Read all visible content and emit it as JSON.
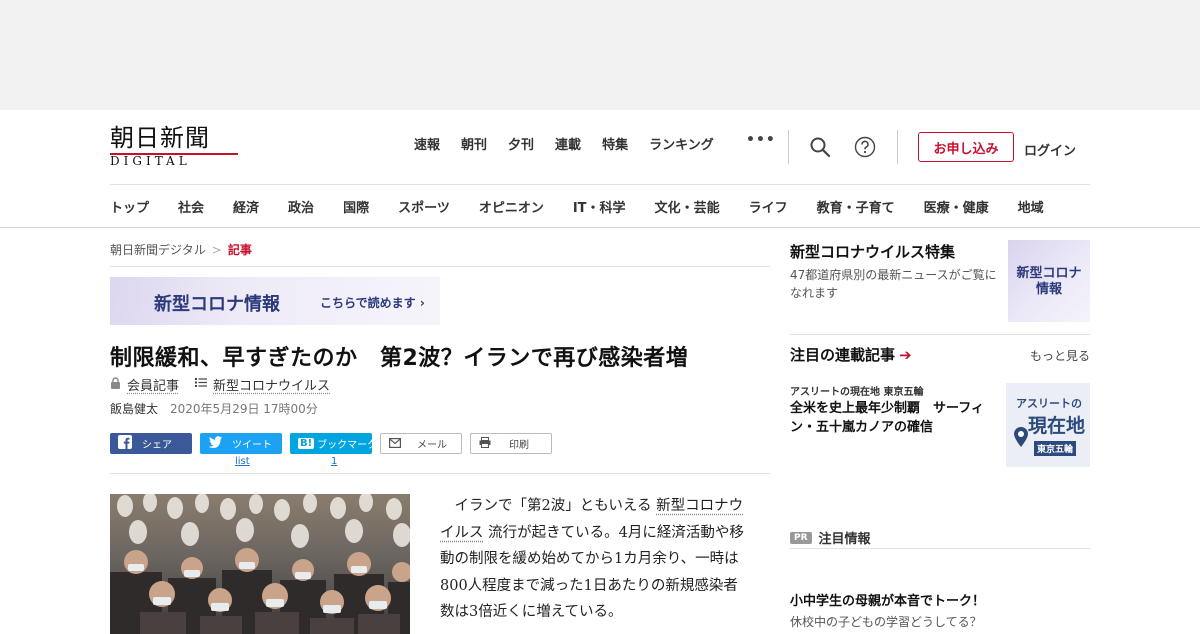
{
  "site": {
    "logo_main": "朝日新聞",
    "logo_sub": "DIGITAL"
  },
  "topnav": {
    "items": [
      "速報",
      "朝刊",
      "夕刊",
      "連載",
      "特集",
      "ランキング"
    ],
    "more": "•••",
    "apply_label": "お申し込み",
    "login_label": "ログイン"
  },
  "catnav": {
    "items": [
      "トップ",
      "社会",
      "経済",
      "政治",
      "国際",
      "スポーツ",
      "オピニオン",
      "IT・科学",
      "文化・芸能",
      "ライフ",
      "教育・子育て",
      "医療・健康",
      "地域"
    ]
  },
  "breadcrumb": {
    "home": "朝日新聞デジタル",
    "sep": ">",
    "current": "記事"
  },
  "covid_banner": {
    "title": "新型コロナ情報",
    "link": "こちらで読めます"
  },
  "article": {
    "headline": "制限緩和、早すぎたのか　第2波？イランで再び感染者増",
    "member_label": "会員記事",
    "topic_label": "新型コロナウイルス",
    "author": "飯島健太",
    "date": "2020年5月29日 17時00分",
    "body_1": "イランで「第2波」ともいえる",
    "body_kw": "新型コロナウイルス",
    "body_2": "流行が起きている。4月に経済活動や移動の制限を緩め始めてから1カ月余り、一時は800人程度まで減った1日あたりの新規感染者数は3倍近くに増えている。"
  },
  "share": {
    "facebook": "シェア",
    "twitter": "ツイート",
    "hatena": "ブックマーク",
    "mail": "メール",
    "print": "印刷",
    "twitter_count": "list",
    "hatena_count": "1"
  },
  "sidebar": {
    "feature_title": "新型コロナウイルス特集",
    "feature_desc": "47都道府県別の最新ニュースがご覧になれます",
    "feature_thumb": "新型コロナ\n情報",
    "series_title": "注目の連載記事",
    "series_more": "もっと見る",
    "series_label": "アスリートの現在地 東京五輪",
    "series_headline": "全米を史上最年少制覇　サーフィン・五十嵐カノアの確信",
    "series_thumb_a": "アスリートの",
    "series_thumb_b": "現在地",
    "series_thumb_c": "東京五輪",
    "pr_badge": "PR",
    "pr_title": "注目情報",
    "pr_headline": "小中学生の母親が本音でトーク！",
    "pr_sub": "休校中の子どもの学習どうしてる？"
  },
  "colors": {
    "brand_red": "#c8102e",
    "covid_navy": "#2b3a7c",
    "facebook": "#3b5998",
    "twitter": "#1da1f2",
    "hatena": "#00a4de"
  }
}
